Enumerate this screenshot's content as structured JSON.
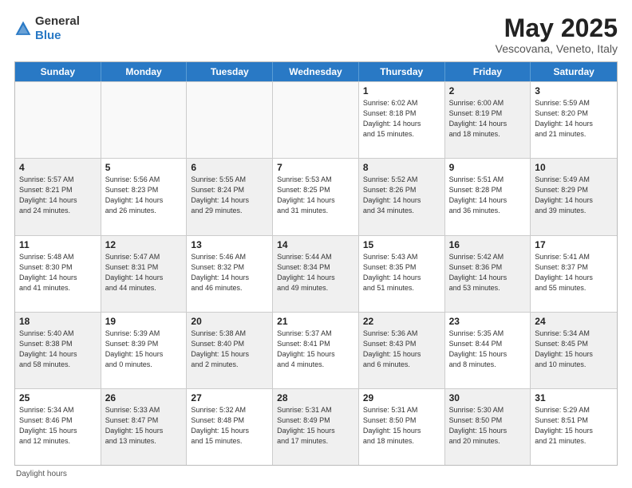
{
  "header": {
    "logo_general": "General",
    "logo_blue": "Blue",
    "title": "May 2025",
    "subtitle": "Vescovana, Veneto, Italy"
  },
  "calendar": {
    "days_of_week": [
      "Sunday",
      "Monday",
      "Tuesday",
      "Wednesday",
      "Thursday",
      "Friday",
      "Saturday"
    ],
    "weeks": [
      [
        {
          "day": "",
          "info": "",
          "empty": true
        },
        {
          "day": "",
          "info": "",
          "empty": true
        },
        {
          "day": "",
          "info": "",
          "empty": true
        },
        {
          "day": "",
          "info": "",
          "empty": true
        },
        {
          "day": "1",
          "info": "Sunrise: 6:02 AM\nSunset: 8:18 PM\nDaylight: 14 hours\nand 15 minutes.",
          "shaded": false
        },
        {
          "day": "2",
          "info": "Sunrise: 6:00 AM\nSunset: 8:19 PM\nDaylight: 14 hours\nand 18 minutes.",
          "shaded": true
        },
        {
          "day": "3",
          "info": "Sunrise: 5:59 AM\nSunset: 8:20 PM\nDaylight: 14 hours\nand 21 minutes.",
          "shaded": false
        }
      ],
      [
        {
          "day": "4",
          "info": "Sunrise: 5:57 AM\nSunset: 8:21 PM\nDaylight: 14 hours\nand 24 minutes.",
          "shaded": true
        },
        {
          "day": "5",
          "info": "Sunrise: 5:56 AM\nSunset: 8:23 PM\nDaylight: 14 hours\nand 26 minutes.",
          "shaded": false
        },
        {
          "day": "6",
          "info": "Sunrise: 5:55 AM\nSunset: 8:24 PM\nDaylight: 14 hours\nand 29 minutes.",
          "shaded": true
        },
        {
          "day": "7",
          "info": "Sunrise: 5:53 AM\nSunset: 8:25 PM\nDaylight: 14 hours\nand 31 minutes.",
          "shaded": false
        },
        {
          "day": "8",
          "info": "Sunrise: 5:52 AM\nSunset: 8:26 PM\nDaylight: 14 hours\nand 34 minutes.",
          "shaded": true
        },
        {
          "day": "9",
          "info": "Sunrise: 5:51 AM\nSunset: 8:28 PM\nDaylight: 14 hours\nand 36 minutes.",
          "shaded": false
        },
        {
          "day": "10",
          "info": "Sunrise: 5:49 AM\nSunset: 8:29 PM\nDaylight: 14 hours\nand 39 minutes.",
          "shaded": true
        }
      ],
      [
        {
          "day": "11",
          "info": "Sunrise: 5:48 AM\nSunset: 8:30 PM\nDaylight: 14 hours\nand 41 minutes.",
          "shaded": false
        },
        {
          "day": "12",
          "info": "Sunrise: 5:47 AM\nSunset: 8:31 PM\nDaylight: 14 hours\nand 44 minutes.",
          "shaded": true
        },
        {
          "day": "13",
          "info": "Sunrise: 5:46 AM\nSunset: 8:32 PM\nDaylight: 14 hours\nand 46 minutes.",
          "shaded": false
        },
        {
          "day": "14",
          "info": "Sunrise: 5:44 AM\nSunset: 8:34 PM\nDaylight: 14 hours\nand 49 minutes.",
          "shaded": true
        },
        {
          "day": "15",
          "info": "Sunrise: 5:43 AM\nSunset: 8:35 PM\nDaylight: 14 hours\nand 51 minutes.",
          "shaded": false
        },
        {
          "day": "16",
          "info": "Sunrise: 5:42 AM\nSunset: 8:36 PM\nDaylight: 14 hours\nand 53 minutes.",
          "shaded": true
        },
        {
          "day": "17",
          "info": "Sunrise: 5:41 AM\nSunset: 8:37 PM\nDaylight: 14 hours\nand 55 minutes.",
          "shaded": false
        }
      ],
      [
        {
          "day": "18",
          "info": "Sunrise: 5:40 AM\nSunset: 8:38 PM\nDaylight: 14 hours\nand 58 minutes.",
          "shaded": true
        },
        {
          "day": "19",
          "info": "Sunrise: 5:39 AM\nSunset: 8:39 PM\nDaylight: 15 hours\nand 0 minutes.",
          "shaded": false
        },
        {
          "day": "20",
          "info": "Sunrise: 5:38 AM\nSunset: 8:40 PM\nDaylight: 15 hours\nand 2 minutes.",
          "shaded": true
        },
        {
          "day": "21",
          "info": "Sunrise: 5:37 AM\nSunset: 8:41 PM\nDaylight: 15 hours\nand 4 minutes.",
          "shaded": false
        },
        {
          "day": "22",
          "info": "Sunrise: 5:36 AM\nSunset: 8:43 PM\nDaylight: 15 hours\nand 6 minutes.",
          "shaded": true
        },
        {
          "day": "23",
          "info": "Sunrise: 5:35 AM\nSunset: 8:44 PM\nDaylight: 15 hours\nand 8 minutes.",
          "shaded": false
        },
        {
          "day": "24",
          "info": "Sunrise: 5:34 AM\nSunset: 8:45 PM\nDaylight: 15 hours\nand 10 minutes.",
          "shaded": true
        }
      ],
      [
        {
          "day": "25",
          "info": "Sunrise: 5:34 AM\nSunset: 8:46 PM\nDaylight: 15 hours\nand 12 minutes.",
          "shaded": false
        },
        {
          "day": "26",
          "info": "Sunrise: 5:33 AM\nSunset: 8:47 PM\nDaylight: 15 hours\nand 13 minutes.",
          "shaded": true
        },
        {
          "day": "27",
          "info": "Sunrise: 5:32 AM\nSunset: 8:48 PM\nDaylight: 15 hours\nand 15 minutes.",
          "shaded": false
        },
        {
          "day": "28",
          "info": "Sunrise: 5:31 AM\nSunset: 8:49 PM\nDaylight: 15 hours\nand 17 minutes.",
          "shaded": true
        },
        {
          "day": "29",
          "info": "Sunrise: 5:31 AM\nSunset: 8:50 PM\nDaylight: 15 hours\nand 18 minutes.",
          "shaded": false
        },
        {
          "day": "30",
          "info": "Sunrise: 5:30 AM\nSunset: 8:50 PM\nDaylight: 15 hours\nand 20 minutes.",
          "shaded": true
        },
        {
          "day": "31",
          "info": "Sunrise: 5:29 AM\nSunset: 8:51 PM\nDaylight: 15 hours\nand 21 minutes.",
          "shaded": false
        }
      ]
    ]
  },
  "footer": {
    "note": "Daylight hours"
  }
}
